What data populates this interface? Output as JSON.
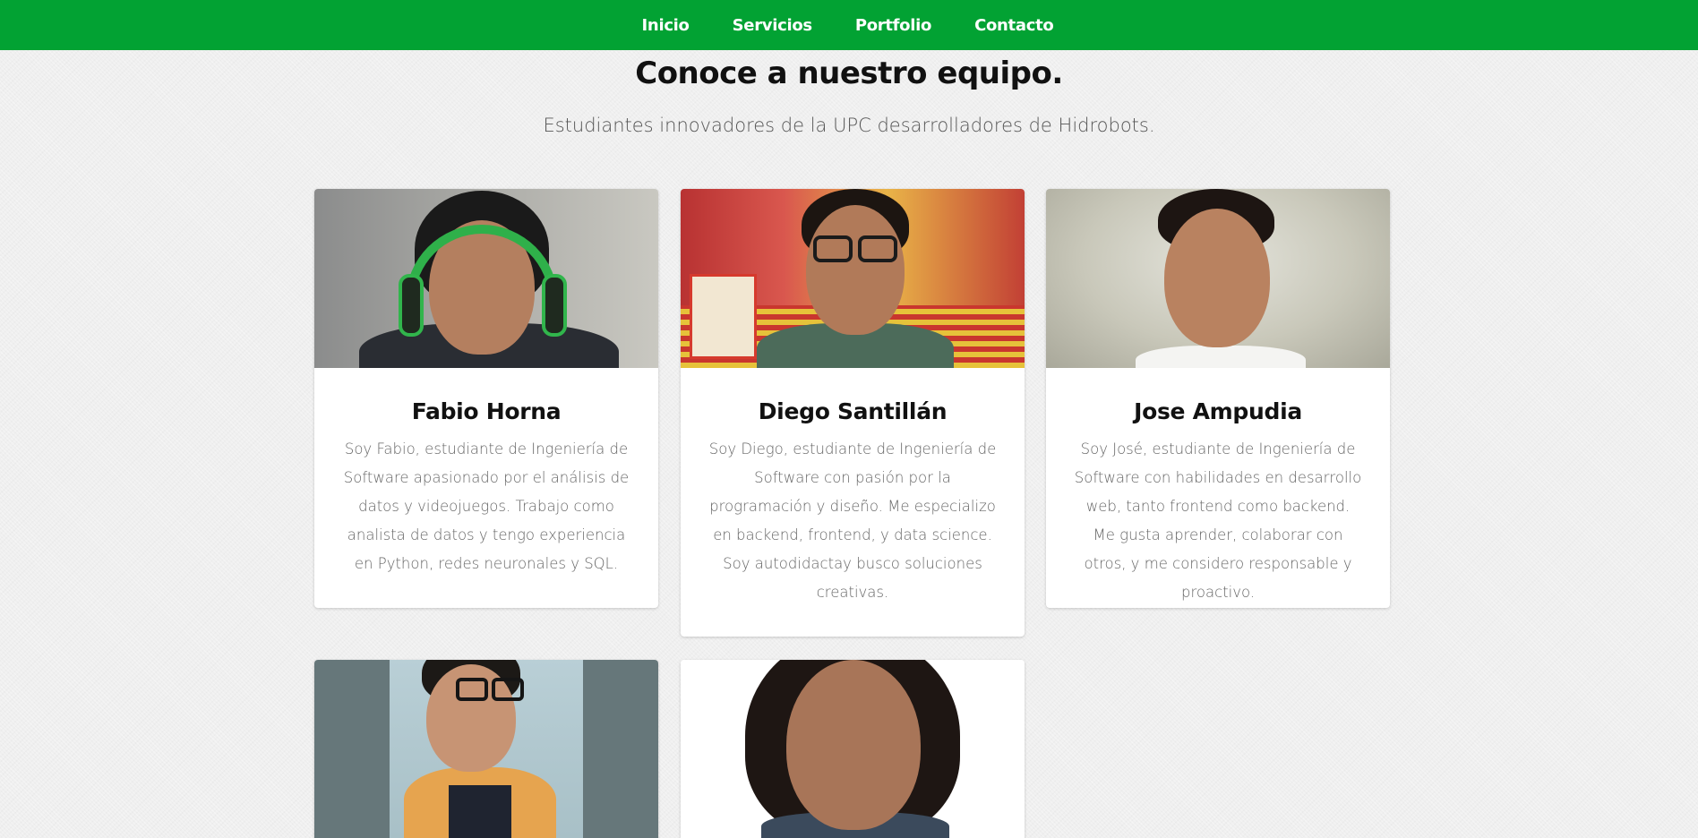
{
  "nav": {
    "items": [
      {
        "label": "Inicio"
      },
      {
        "label": "Servicios"
      },
      {
        "label": "Portfolio"
      },
      {
        "label": "Contacto"
      }
    ],
    "background": "#02a233"
  },
  "team": {
    "title": "Conoce a nuestro equipo.",
    "subtitle": "Estudiantes innovadores de la UPC desarrolladores de Hidrobots.",
    "members": [
      {
        "name": "Fabio Horna",
        "description": "Soy Fabio, estudiante de Ingeniería de Software apasionado por el análisis de datos y videojuegos. Trabajo como analista de datos y tengo experiencia en Python, redes neuronales y SQL.",
        "photo": "person-with-green-headset"
      },
      {
        "name": "Diego Santillán",
        "description": "Soy Diego, estudiante de Ingeniería de Software con pasión por la programación y diseño. Me especializo en backend, frontend, y data science. Soy autodidactay busco soluciones creativas.",
        "photo": "person-with-glasses-smiling"
      },
      {
        "name": "Jose Ampudia",
        "description": "Soy José, estudiante de Ingeniería de Software con habilidades en desarrollo web, tanto frontend como backend. Me gusta aprender, colaborar con otros, y me considero responsable y proactivo.",
        "photo": "young-man-portrait"
      },
      {
        "name": "",
        "description": "",
        "photo": "person-with-glasses-orange-jacket"
      },
      {
        "name": "",
        "description": "",
        "photo": "woman-portrait-white-background"
      }
    ]
  }
}
